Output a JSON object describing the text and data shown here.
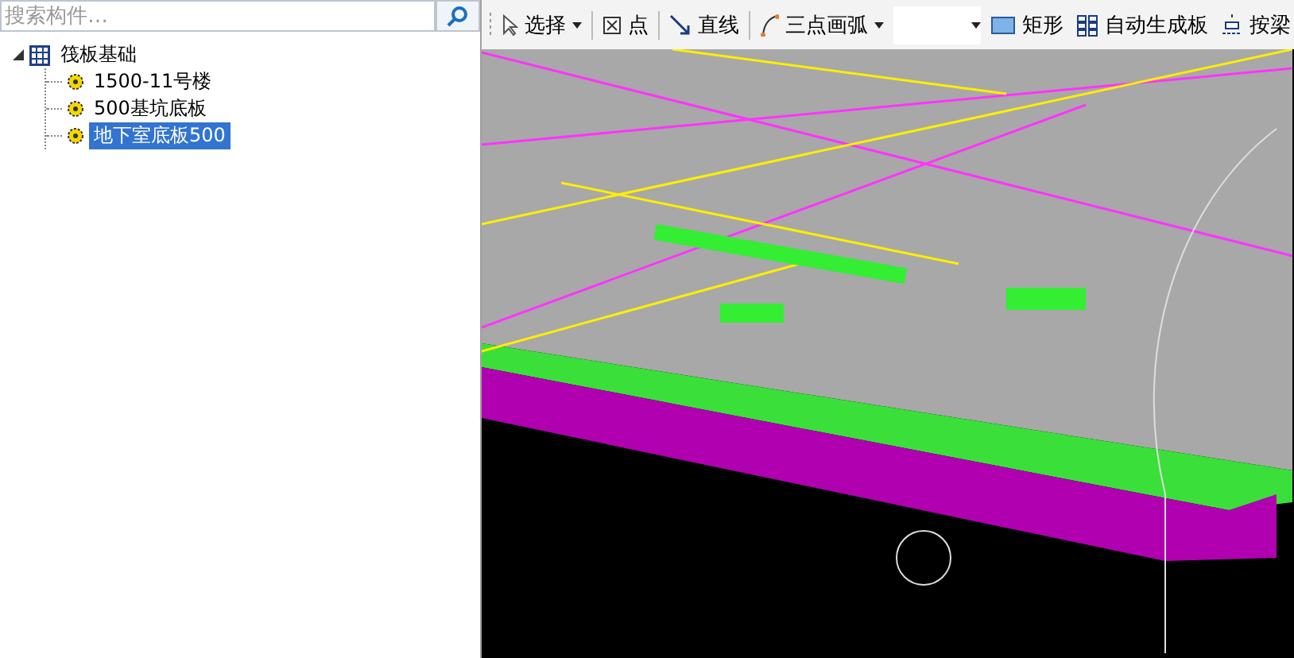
{
  "search": {
    "placeholder": "搜索构件…"
  },
  "tree": [
    {
      "label": "筏板基础",
      "expanded": true,
      "selected": false,
      "children": [
        {
          "label": "1500-11号楼",
          "selected": false
        },
        {
          "label": "500基坑底板",
          "selected": false
        },
        {
          "label": "地下室底板500",
          "selected": true
        }
      ]
    }
  ],
  "toolbar": [
    {
      "kind": "tool",
      "label": "选择",
      "dropdown": true
    },
    {
      "kind": "tool",
      "label": "点",
      "dropdown": false
    },
    {
      "kind": "tool",
      "label": "直线",
      "dropdown": false
    },
    {
      "kind": "tool",
      "label": "三点画弧",
      "dropdown": true
    },
    {
      "kind": "combo"
    },
    {
      "kind": "tool",
      "label": "矩形",
      "dropdown": false
    },
    {
      "kind": "tool",
      "label": "自动生成板",
      "dropdown": false
    },
    {
      "kind": "tool",
      "label": "按梁",
      "dropdown": false
    }
  ]
}
